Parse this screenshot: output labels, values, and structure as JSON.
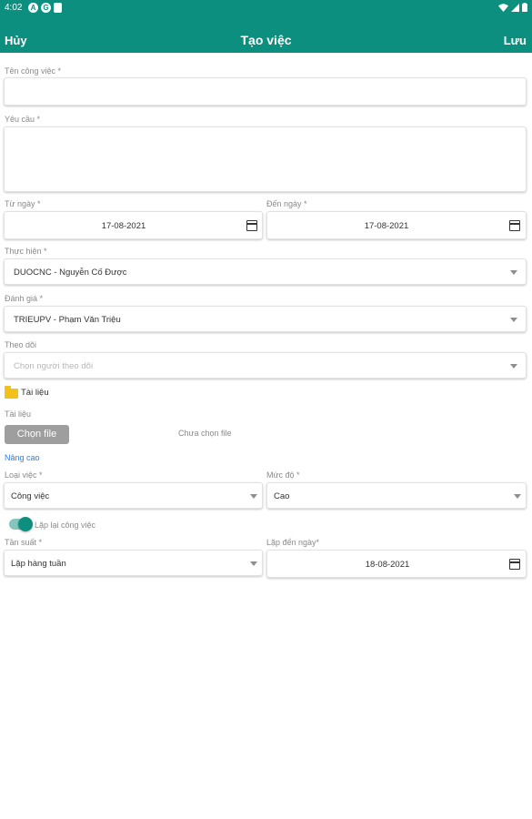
{
  "status_bar": {
    "time": "4:02",
    "icons": [
      "A",
      "G",
      "clipboard"
    ],
    "right_icons": [
      "wifi-icon",
      "signal-icon",
      "battery-icon"
    ]
  },
  "app_bar": {
    "cancel_label": "Hủy",
    "title": "Tạo việc",
    "save_label": "Lưu"
  },
  "form": {
    "task_name": {
      "label": "Tên công việc *",
      "value": ""
    },
    "requirement": {
      "label": "Yêu cầu *",
      "value": ""
    },
    "from_date": {
      "label": "Từ ngày *",
      "value": "17-08-2021"
    },
    "to_date": {
      "label": "Đến ngày *",
      "value": "17-08-2021"
    },
    "assignee": {
      "label": "Thực hiện *",
      "value": "DUOCNC - Nguyễn Cố Được"
    },
    "reviewer": {
      "label": "Đánh giá *",
      "value": "TRIEUPV - Phạm Văn Triệu"
    },
    "followers": {
      "label": "Theo dõi",
      "placeholder": "Chọn người theo dõi"
    },
    "documents_section": "Tài liệu",
    "file": {
      "label": "Tài liệu",
      "button": "Chọn file",
      "status": "Chưa chọn file"
    },
    "advanced_link": "Nâng cao",
    "task_type": {
      "label": "Loại việc *",
      "value": "Công việc"
    },
    "priority": {
      "label": "Mức độ *",
      "value": "Cao"
    },
    "repeat": {
      "label": "Lặp lại công việc",
      "enabled": true
    },
    "frequency": {
      "label": "Tần suất *",
      "value": "Lặp hàng tuần"
    },
    "repeat_until": {
      "label": "Lặp đến ngày*",
      "value": "18-08-2021"
    }
  },
  "colors": {
    "primary": "#0d8f7f",
    "link": "#2f7de1",
    "folder": "#f2c21b",
    "button_disabled": "#9e9e9e"
  }
}
